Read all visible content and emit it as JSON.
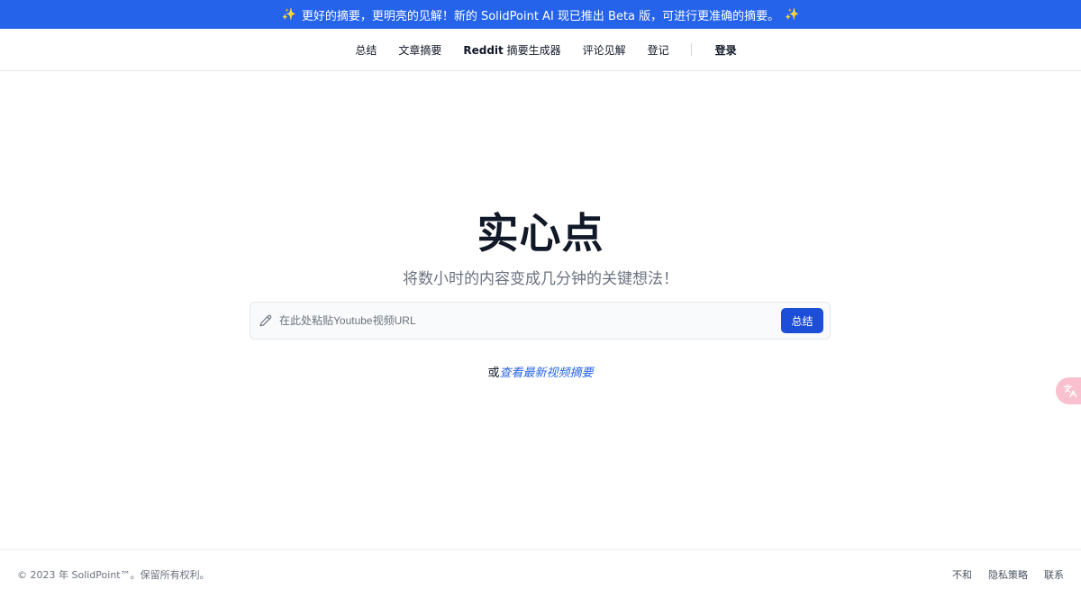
{
  "banner": {
    "icon_left": "sparkle-icon",
    "text": "更好的摘要，更明亮的见解！新的 SolidPoint AI 现已推出 Beta 版，可进行更准确的摘要。",
    "icon_right": "sparkle-icon",
    "background": "#2563eb"
  },
  "nav": {
    "items": [
      {
        "label": "总结"
      },
      {
        "label": "文章摘要"
      },
      {
        "label_bold": "Reddit",
        "label": " 摘要生成器"
      },
      {
        "label": "评论见解"
      },
      {
        "label": "登记"
      }
    ],
    "login_label": "登录"
  },
  "hero": {
    "title": "实心点",
    "subtitle": "将数小时的内容变成几分钟的关键想法！",
    "input_placeholder": "在此处粘贴Youtube视频URL",
    "input_value": "",
    "submit_label": "总结",
    "or_text": "或",
    "latest_link": "查看最新视频摘要"
  },
  "translate_badge": {
    "icon": "translate-icon",
    "color": "#f9c0d0"
  },
  "footer": {
    "copyright": "© 2023 年 SolidPoint™。保留所有权利。",
    "links": [
      "不和",
      "隐私策略",
      "联系"
    ]
  },
  "colors": {
    "accent": "#2563eb",
    "button": "#1d4ed8"
  }
}
